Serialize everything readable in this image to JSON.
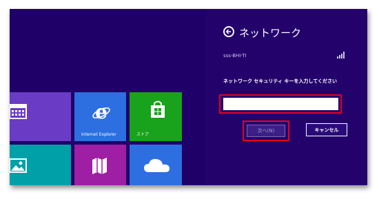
{
  "colors": {
    "start_background": "#1f0068",
    "charm_background": "#24026c",
    "highlight": "#e8001c"
  },
  "tiles": {
    "calendar": {
      "icon": "calendar-icon"
    },
    "ie": {
      "label": "Internet Explorer",
      "icon": "internet-explorer-icon"
    },
    "store": {
      "label": "ストア",
      "icon": "store-icon"
    },
    "photos": {
      "icon": "photos-icon"
    },
    "maps": {
      "icon": "maps-icon"
    },
    "skydrive": {
      "icon": "skydrive-cloud-icon"
    }
  },
  "network_panel": {
    "title": "ネットワーク",
    "back_icon": "back-arrow-icon",
    "ssid": "sss-BHI-TI",
    "signal_icon": "wifi-signal-icon",
    "prompt": "ネットワーク セキュリティ キーを入力してください",
    "key_value": "",
    "next_label": "次へ(N)",
    "cancel_label": "キャンセル"
  }
}
